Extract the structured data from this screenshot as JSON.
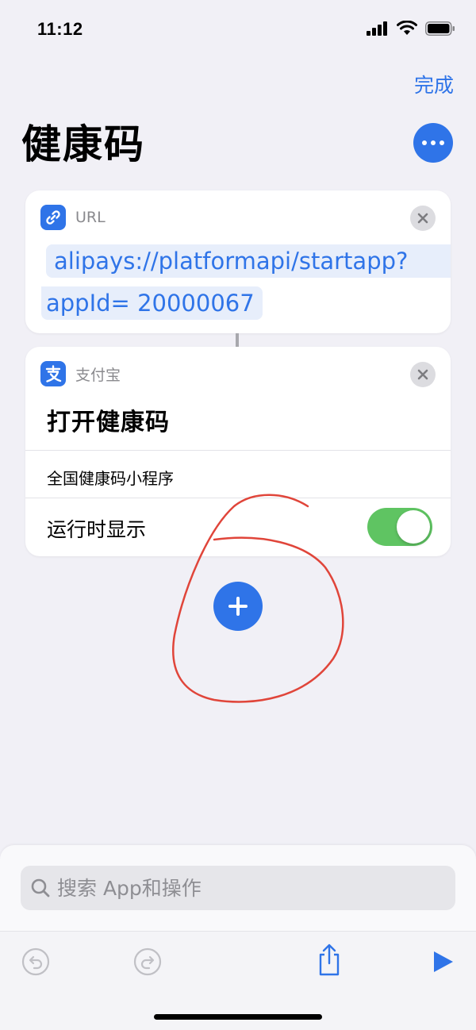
{
  "status_bar": {
    "time": "11:12"
  },
  "header": {
    "done_label": "完成",
    "title": "健康码"
  },
  "url_action": {
    "header_label": "URL",
    "url_line_1": "alipays://platformapi/startapp?",
    "url_line_2": "appId= 20000067"
  },
  "alipay_action": {
    "header_label": "支付宝",
    "title": "打开健康码",
    "parameter_value": "全国健康码小程序",
    "show_when_run_label": "运行时显示",
    "show_when_run_enabled": true
  },
  "search": {
    "placeholder": "搜索 App和操作"
  },
  "colors": {
    "accent": "#2f74e8",
    "background": "#f1f0f6",
    "toggle_on": "#5fc462",
    "annotation": "#e0453a"
  },
  "icons": {
    "url_action": "link-icon",
    "alipay_action": "alipay-icon",
    "undo": "undo-icon",
    "redo": "redo-icon",
    "share": "share-icon",
    "run": "play-icon"
  }
}
